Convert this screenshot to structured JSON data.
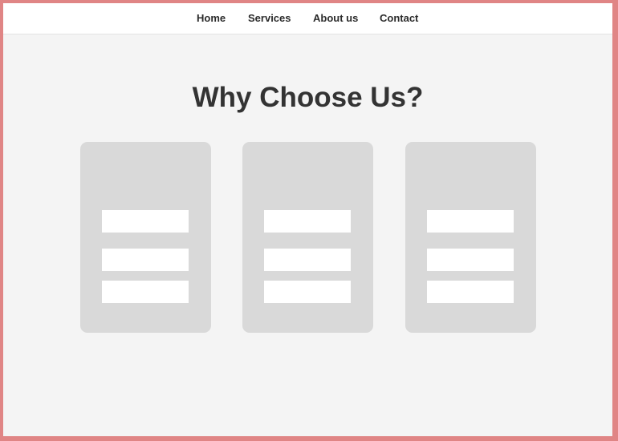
{
  "nav": {
    "items": [
      {
        "label": "Home"
      },
      {
        "label": "Services"
      },
      {
        "label": "About us"
      },
      {
        "label": "Contact"
      }
    ]
  },
  "main": {
    "heading": "Why Choose Us?",
    "card_count": 3,
    "placeholder_lines_per_card": 3
  },
  "colors": {
    "page_border": "#e08585",
    "background": "#f4f4f4",
    "navbar": "#ffffff",
    "card": "#d9d9d9",
    "placeholder": "#ffffff",
    "text": "#333333"
  }
}
